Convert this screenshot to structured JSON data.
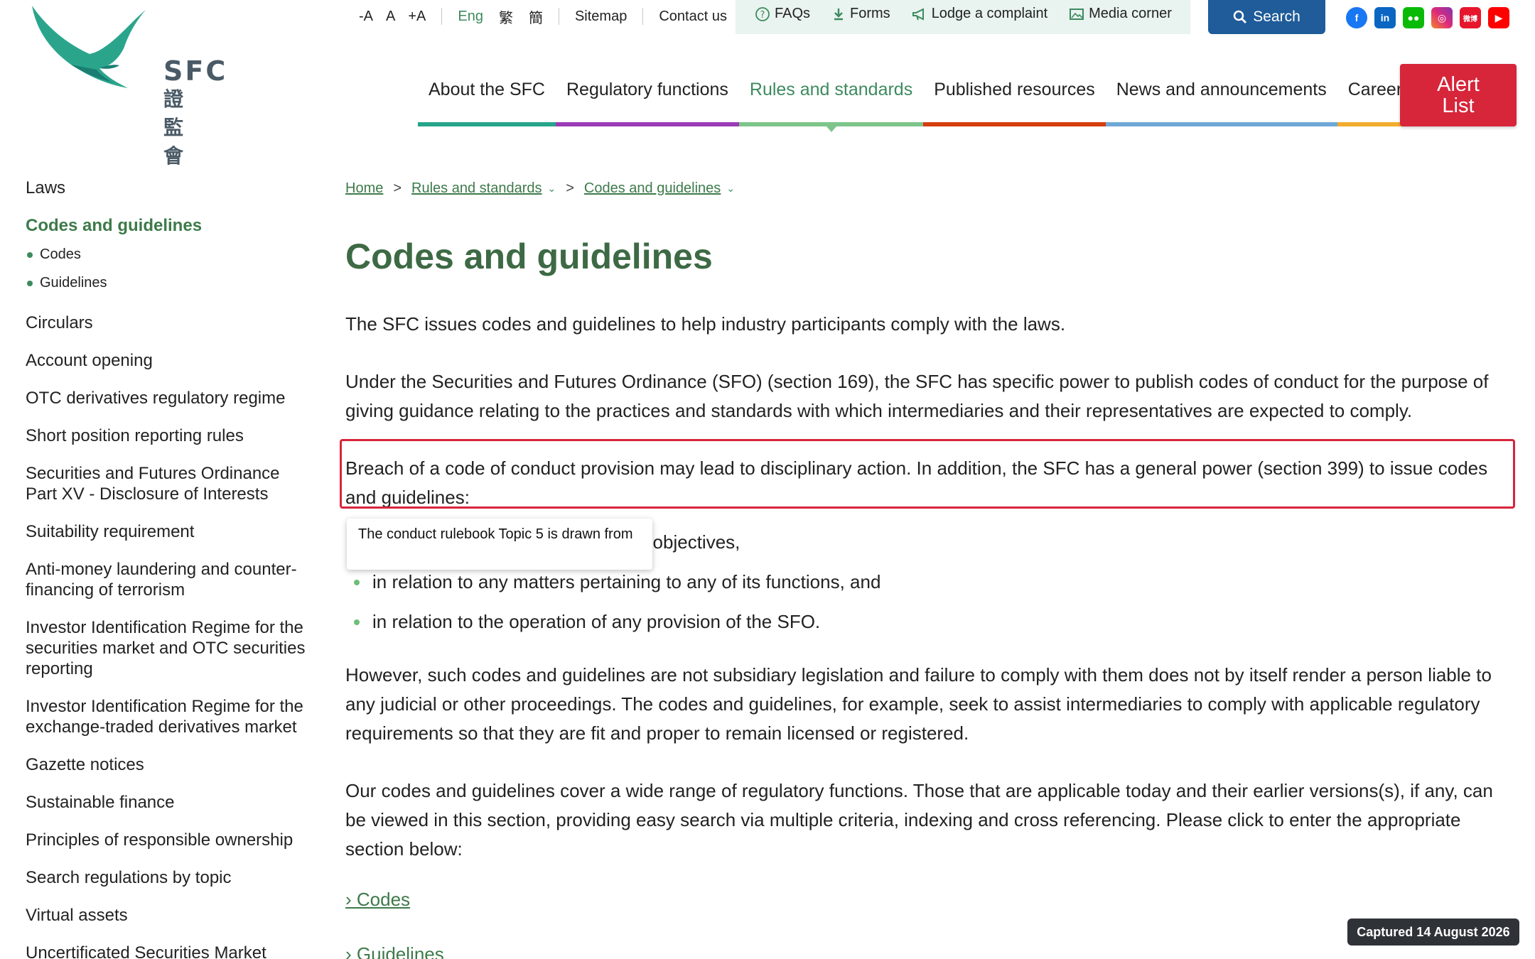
{
  "logo": {
    "text": "SFC",
    "chinese": "證監會"
  },
  "utility": {
    "font_small": "-A",
    "font_normal": "A",
    "font_large": "+A",
    "lang_eng": "Eng",
    "lang_trad": "繁",
    "lang_simp": "簡",
    "sitemap": "Sitemap",
    "contact": "Contact us",
    "faqs": "FAQs",
    "forms": "Forms",
    "complaint": "Lodge a complaint",
    "media": "Media corner",
    "search": "Search",
    "weibo": "微博"
  },
  "nav": [
    {
      "label": "About the SFC",
      "color": "#26a58a"
    },
    {
      "label": "Regulatory functions",
      "color": "#9b3bb5"
    },
    {
      "label": "Rules and standards",
      "color": "#7ec58b"
    },
    {
      "label": "Published resources",
      "color": "#d63d0f"
    },
    {
      "label": "News and announcements",
      "color": "#6fa8d6"
    },
    {
      "label": "Career",
      "color": "#f2ad2e"
    }
  ],
  "alert": {
    "line1": "Alert",
    "line2": "List"
  },
  "sidebar": {
    "items": [
      "Laws",
      "Codes and guidelines",
      "Circulars",
      "Account opening",
      "OTC derivatives regulatory regime",
      "Short position reporting rules",
      "Securities and Futures Ordinance Part XV - Disclosure of Interests",
      "Suitability requirement",
      "Anti-money laundering and counter-financing of terrorism",
      "Investor Identification Regime for the securities market and OTC securities reporting",
      "Investor Identification Regime for the exchange-traded derivatives market",
      "Gazette notices",
      "Sustainable finance",
      "Principles of responsible ownership",
      "Search regulations by topic",
      "Virtual assets",
      "Uncertificated Securities Market"
    ],
    "sub": [
      "Codes",
      "Guidelines"
    ]
  },
  "breadcrumb": {
    "home": "Home",
    "level1": "Rules and standards",
    "level2": "Codes and guidelines",
    "separator": ">"
  },
  "page": {
    "title": "Codes and guidelines",
    "p1": "The SFC issues codes and guidelines to help industry participants comply with the laws.",
    "p2": "Under the Securities and Futures Ordinance (SFO) (section 169), the SFC has specific power to publish codes of conduct for the purpose of giving guidance relating to the practices and standards with which intermediaries and their representatives are expected to comply.",
    "p3": "Breach of a code of conduct provision may lead to disciplinary action. In addition, the SFC has a general power (section 399) to issue codes and guidelines:",
    "bullets": [
      "in the furtherance of its regulatory objectives,",
      "in relation to any matters pertaining to any of its functions, and",
      "in relation to the operation of any provision of the SFO."
    ],
    "p4": "However, such codes and guidelines are not subsidiary legislation and failure to comply with them does not by itself render a person liable to any judicial or other proceedings. The codes and guidelines, for example, seek to assist intermediaries to comply with applicable regulatory requirements so that they are fit and proper to remain licensed or registered.",
    "p5": "Our codes and guidelines cover a wide range of regulatory functions. Those that are applicable today and their earlier versions(s), if any, can be viewed in this section, providing easy search via multiple criteria, indexing and cross referencing. Please click to enter the appropriate section below:",
    "link_codes": "› Codes",
    "link_guidelines": "› Guidelines"
  },
  "tooltip": {
    "text": "The conduct rulebook Topic 5 is drawn from"
  },
  "captured": "Captured 14 August 2026"
}
